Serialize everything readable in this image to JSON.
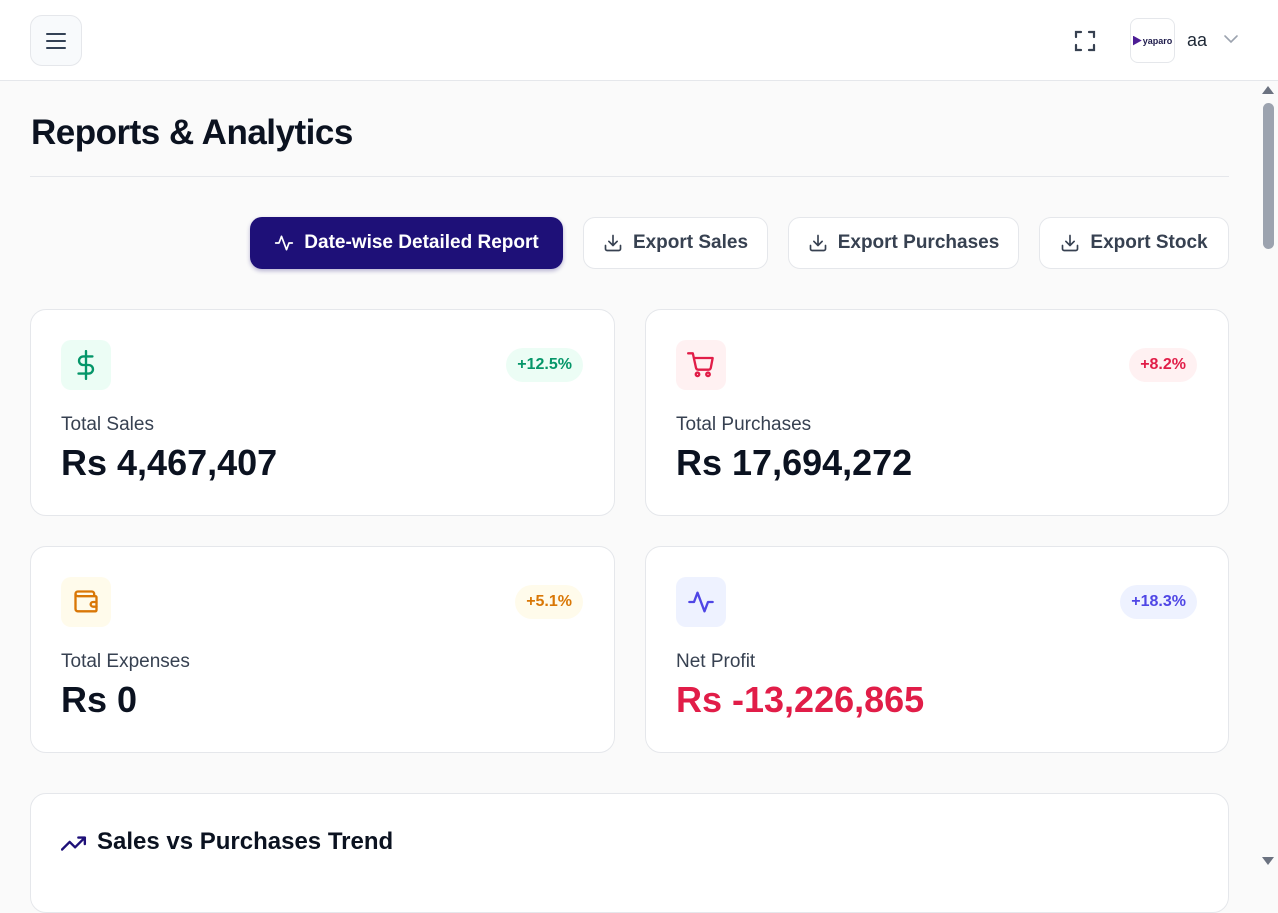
{
  "header": {
    "menu_icon": "hamburger-icon",
    "fullscreen_icon": "fullscreen-icon",
    "brand_logo_text": "yaparo",
    "user_name": "aa",
    "dropdown_icon": "chevron-down-icon"
  },
  "page": {
    "title": "Reports & Analytics"
  },
  "actions": {
    "detailed_report": "Date-wise Detailed Report",
    "export_sales": "Export Sales",
    "export_purchases": "Export Purchases",
    "export_stock": "Export Stock"
  },
  "stats": {
    "sales": {
      "label": "Total Sales",
      "value": "Rs 4,467,407",
      "change": "+12.5%",
      "icon": "dollar-icon",
      "color": "#059669",
      "bg": "#ecfdf5"
    },
    "purchases": {
      "label": "Total Purchases",
      "value": "Rs 17,694,272",
      "change": "+8.2%",
      "icon": "cart-icon",
      "color": "#e11d48",
      "bg": "#fff1f2"
    },
    "expenses": {
      "label": "Total Expenses",
      "value": "Rs 0",
      "change": "+5.1%",
      "icon": "wallet-icon",
      "color": "#d97706",
      "bg": "#fffbeb"
    },
    "profit": {
      "label": "Net Profit",
      "value": "Rs -13,226,865",
      "change": "+18.3%",
      "icon": "activity-icon",
      "color": "#4f46e5",
      "bg": "#eef2ff",
      "value_color": "#e11d48"
    }
  },
  "trend": {
    "title": "Sales vs Purchases Trend",
    "icon": "trending-up-icon"
  }
}
